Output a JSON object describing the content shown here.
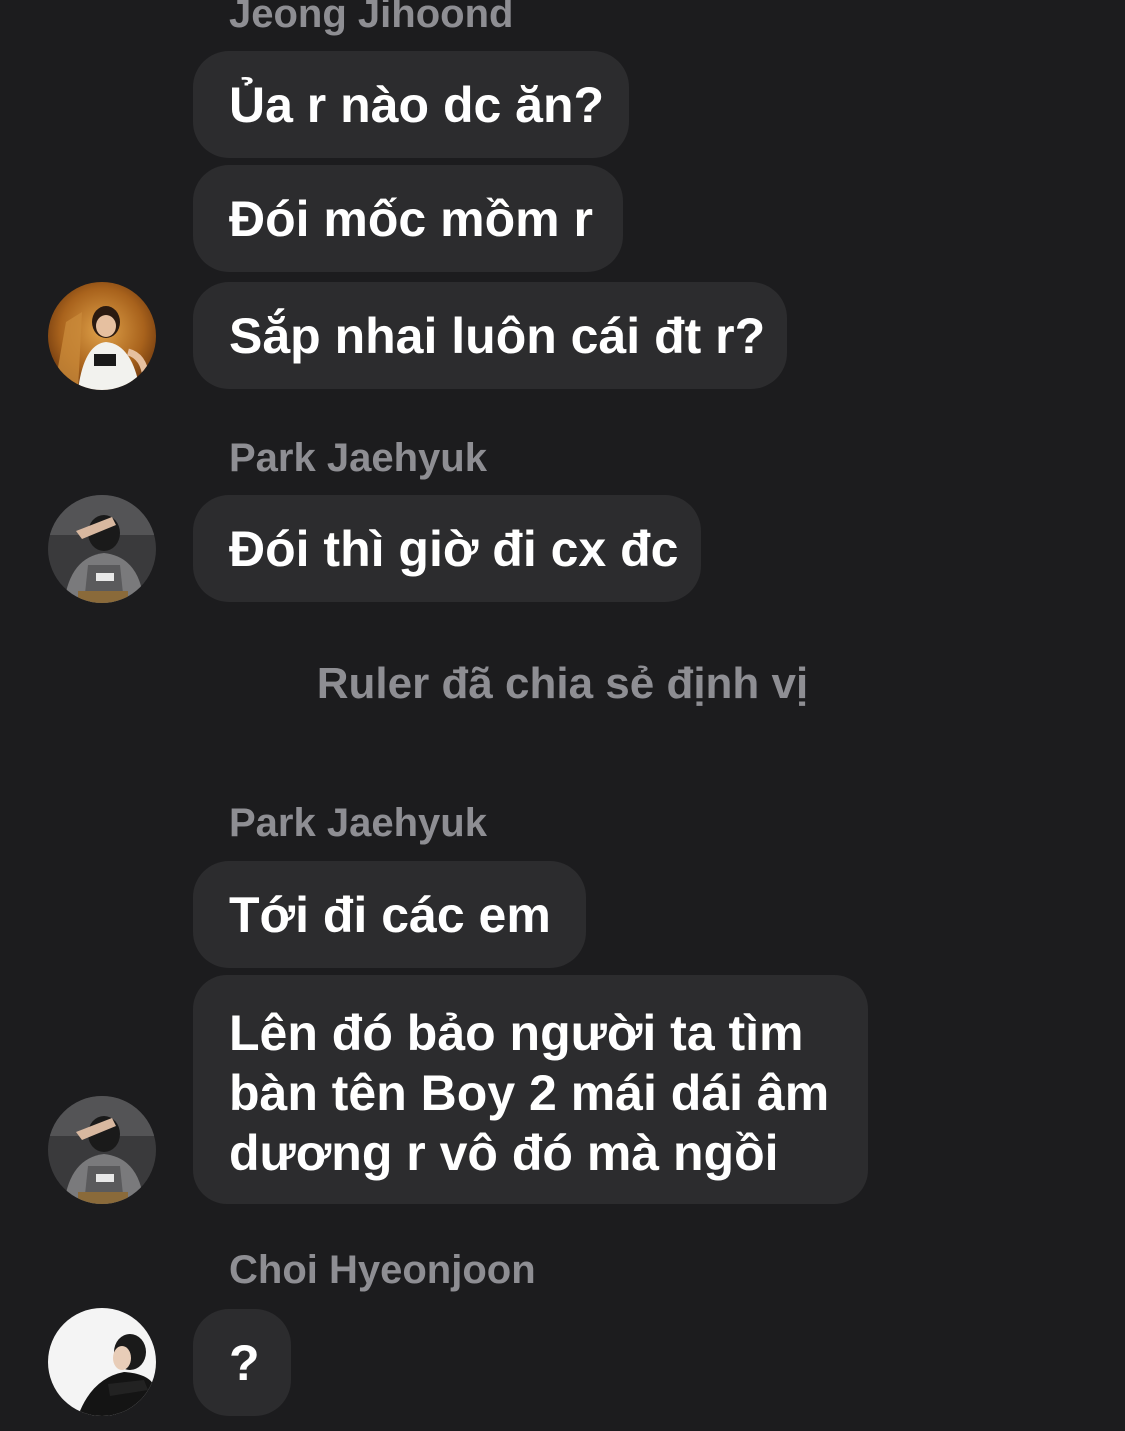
{
  "conversation": {
    "groups": [
      {
        "sender": "Jeong Jihoond",
        "messages": [
          "Ủa r nào dc ăn?",
          "Đói mốc mồm r",
          "Sắp nhai luôn cái đt r?"
        ],
        "avatar": "jihoon-avatar"
      },
      {
        "sender": "Park Jaehyuk",
        "messages": [
          "Đói thì giờ đi cx đc"
        ],
        "avatar": "jaehyuk-avatar"
      },
      {
        "system_note": "Ruler đã chia sẻ định vị"
      },
      {
        "sender": "Park Jaehyuk",
        "messages": [
          "Tới đi các em",
          "Lên đó bảo người ta tìm bàn tên Boy 2 mái dái âm dương r vô đó mà ngồi"
        ],
        "avatar": "jaehyuk-avatar"
      },
      {
        "sender": "Choi Hyeonjoon",
        "messages": [
          "?"
        ],
        "avatar": "hyeonjoon-avatar"
      }
    ]
  },
  "colors": {
    "background": "#1c1c1e",
    "bubble": "#2c2c2e",
    "sender_name": "#8e8e93",
    "message_text": "#ffffff"
  }
}
